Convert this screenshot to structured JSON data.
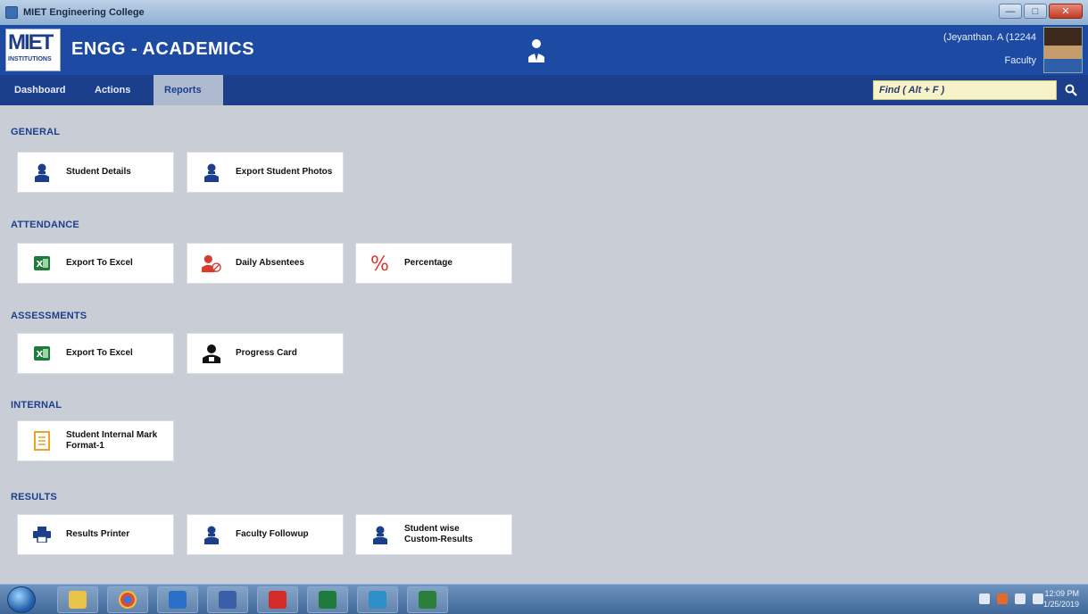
{
  "window": {
    "title": "MIET Engineering College",
    "controls": {
      "minimize": "—",
      "maximize": "□",
      "close": "✕"
    }
  },
  "header": {
    "logo_main": "MIET",
    "logo_sub": "INSTITUTIONS",
    "app_title": "ENGG - ACADEMICS",
    "user_name": "(Jeyanthan. A (12244",
    "user_role": "Faculty"
  },
  "nav": {
    "tabs": [
      {
        "label": "Dashboard"
      },
      {
        "label": "Actions"
      },
      {
        "label": "Reports"
      }
    ],
    "find_placeholder": "Find  ( Alt + F )"
  },
  "sections": [
    {
      "title": "GENERAL",
      "items": [
        {
          "label": "Student Details",
          "icon": "user-icon"
        },
        {
          "label": "Export Student Photos",
          "icon": "user-icon"
        }
      ]
    },
    {
      "title": "ATTENDANCE",
      "items": [
        {
          "label": "Export To Excel",
          "icon": "excel-icon"
        },
        {
          "label": "Daily Absentees",
          "icon": "absentee-icon"
        },
        {
          "label": "Percentage",
          "icon": "percent-icon"
        }
      ]
    },
    {
      "title": "ASSESSMENTS",
      "items": [
        {
          "label": "Export To Excel",
          "icon": "excel-icon"
        },
        {
          "label": "Progress Card",
          "icon": "progress-card-icon"
        }
      ]
    },
    {
      "title": "INTERNAL",
      "items": [
        {
          "label": "Student Internal Mark Format-1",
          "icon": "document-icon"
        }
      ]
    },
    {
      "title": "RESULTS",
      "items": [
        {
          "label": "Results Printer",
          "icon": "printer-icon"
        },
        {
          "label": "Faculty Followup",
          "icon": "user-icon"
        },
        {
          "label": "Student wise Custom-Results",
          "icon": "user-icon"
        }
      ]
    }
  ],
  "taskbar": {
    "clock_time": "12:09 PM",
    "clock_date": "1/25/2019"
  },
  "colors": {
    "header": "#1d4aa3",
    "nav": "#1c3f8c",
    "content_bg": "#c9ced6",
    "section_title": "#1c3f8c",
    "excel_green": "#1f7a3c",
    "absentee_red": "#d83a2f",
    "percent_red": "#d83a2f",
    "document_orange": "#f0a023"
  }
}
